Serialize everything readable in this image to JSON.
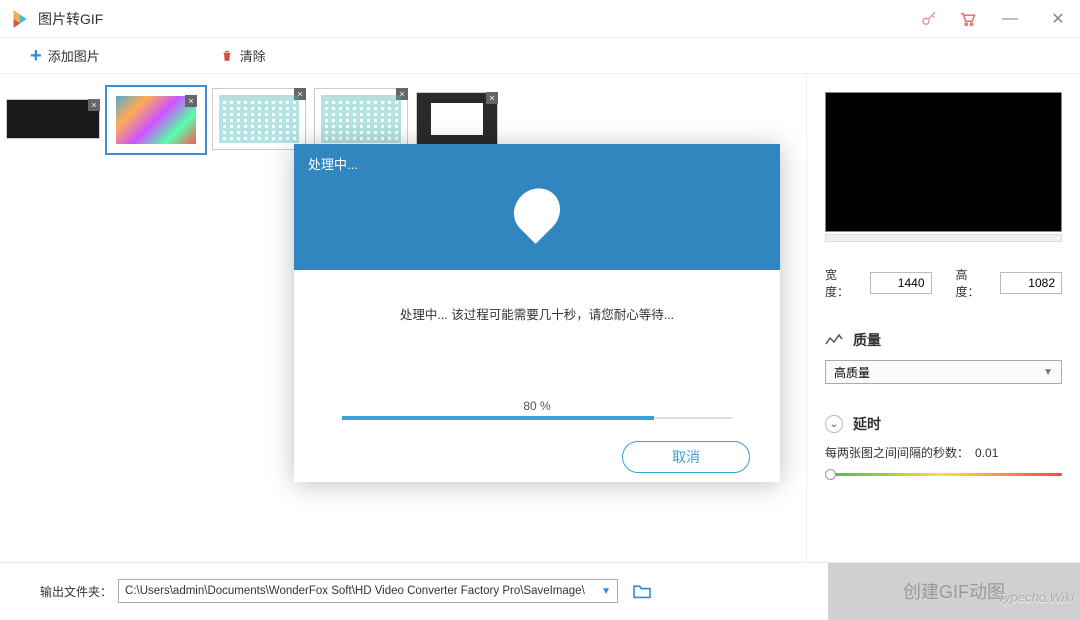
{
  "titlebar": {
    "title": "图片转GIF"
  },
  "toolbar": {
    "add_label": "添加图片",
    "clear_label": "清除"
  },
  "right_panel": {
    "width_label": "宽度：",
    "width_value": "1440",
    "height_label": "高度：",
    "height_value": "1082",
    "quality_label": "质量",
    "quality_value": "高质量",
    "delay_label": "延时",
    "delay_text": "每两张图之间间隔的秒数：",
    "delay_value": "0.01"
  },
  "bottom": {
    "output_label": "输出文件夹：",
    "output_path": "C:\\Users\\admin\\Documents\\WonderFox Soft\\HD Video Converter Factory Pro\\SaveImage\\",
    "create_label": "创建GIF动图"
  },
  "modal": {
    "title": "处理中...",
    "message": "处理中... 该过程可能需要几十秒，请您耐心等待...",
    "progress_pct": "80 %",
    "progress_value": 80,
    "cancel_label": "取消"
  },
  "watermark": "Typecho.Wiki"
}
